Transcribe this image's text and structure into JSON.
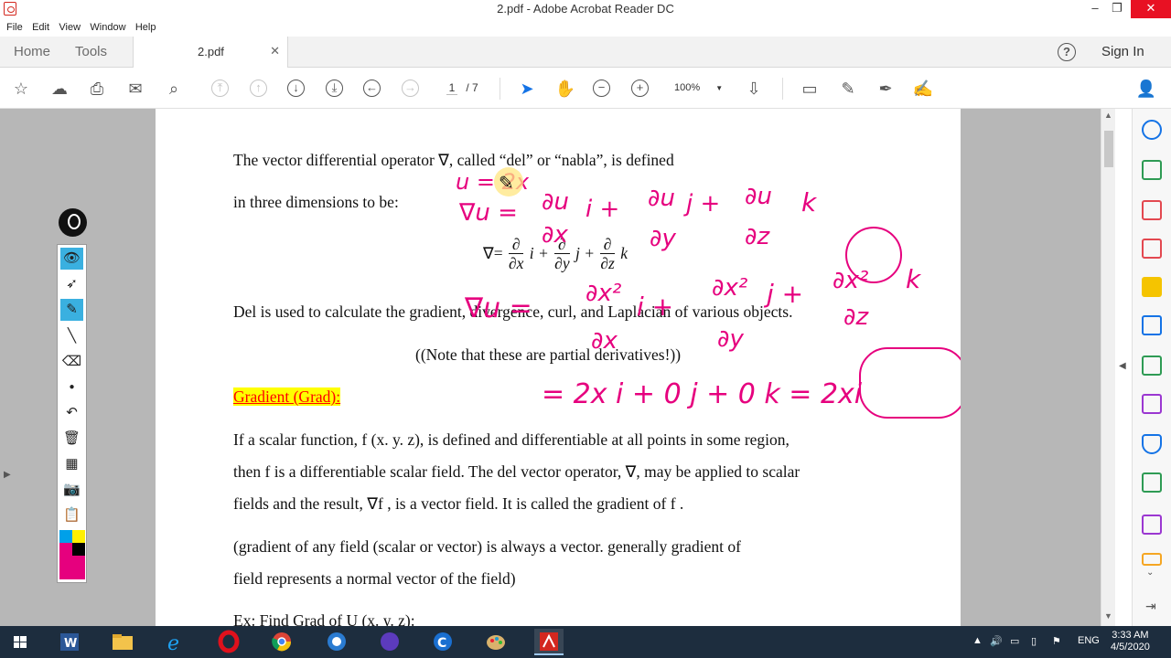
{
  "window": {
    "title": "2.pdf - Adobe Acrobat Reader DC",
    "minimize": "–",
    "maximize": "❐",
    "close": "✕"
  },
  "menu": [
    "File",
    "Edit",
    "View",
    "Window",
    "Help"
  ],
  "tabs": {
    "home": "Home",
    "tools": "Tools",
    "document": "2.pdf",
    "help": "?",
    "signin": "Sign In"
  },
  "toolbar": {
    "page_current": "1",
    "page_total": "/ 7",
    "zoom": "100%"
  },
  "document": {
    "line1": "The vector differential operator ∇, called “del” or “nabla”, is defined",
    "line2": "in three dimensions to be:",
    "formula_lhs": "∇=",
    "formula_parts": {
      "num": "∂",
      "dx": "∂x",
      "dy": "∂y",
      "dz": "∂z",
      "i": "i +",
      "j": "j +",
      "k": "k"
    },
    "line3": "Del is used to calculate the gradient, divergence, curl, and Laplacian of various objects.",
    "line4": "((Note that these are partial derivatives!))",
    "heading": "Gradient (Grad):",
    "p1a": "If a scalar function, f (x. y. z), is defined and differentiable at all points in some region,",
    "p1b": "then f  is a differentiable scalar field. The del vector operator, ∇, may be applied to scalar",
    "p1c": "fields and the result, ∇f , is a vector field. It is called the gradient of f .",
    "p2a": "(gradient of any field (scalar or vector) is always a vector. generally gradient of",
    "p2b": "field represents a normal vector of the field)",
    "p3": "Ex: Find Grad of U (x. y. z):"
  },
  "ink": {
    "color": "#e6007e",
    "l1": "u = 2x",
    "l2a": "∇u =",
    "l2b": "∂u",
    "l2c": "∂x",
    "l2d": "i +",
    "l2e": "∂u",
    "l2f": "∂y",
    "l2g": "j +",
    "l2h": "∂u",
    "l2i": "∂z",
    "l2j": "k",
    "l3a": "∇u =",
    "l3b": "∂x²",
    "l3c": "∂x",
    "l3d": "i +",
    "l3e": "∂x²",
    "l3f": "∂y",
    "l3g": "j +",
    "l3h": "∂x²",
    "l3i": "∂z",
    "l3j": "k",
    "l4": "= 2x i + 0 j + 0 k = 2xi"
  },
  "taskbar": {
    "lang": "ENG",
    "time": "3:33 AM",
    "date": "4/5/2020"
  },
  "colors": {
    "accent": "#1473e6",
    "taskbar": "#1d2d3e",
    "highlight": "#ffff00",
    "heading_text": "#ff0000"
  }
}
